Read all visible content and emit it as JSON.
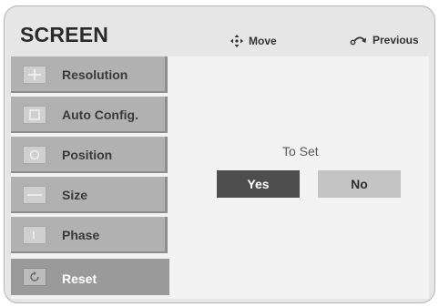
{
  "window": {
    "title": "SCREEN"
  },
  "hints": {
    "move_label": "Move",
    "move_icon": "four-way-arrows-icon",
    "previous_label": "Previous",
    "previous_icon": "return-arrow-icon"
  },
  "menu": {
    "items": [
      {
        "label": "Resolution",
        "icon": "resolution-icon"
      },
      {
        "label": "Auto Config.",
        "icon": "auto-config-icon"
      },
      {
        "label": "Position",
        "icon": "position-icon"
      },
      {
        "label": "Size",
        "icon": "size-icon"
      },
      {
        "label": "Phase",
        "icon": "phase-icon"
      },
      {
        "label": "Reset",
        "icon": "reset-icon",
        "selected": true
      }
    ]
  },
  "dialog": {
    "prompt": "To Set",
    "yes_label": "Yes",
    "no_label": "No",
    "focused": "Yes"
  },
  "colors": {
    "panel_bg": "#e6e6e6",
    "menu_item_bg": "#b1b1b1",
    "selected_item_bg": "#9a9a9a",
    "yes_button_bg": "#4e4e4e",
    "no_button_bg": "#c4c4c4"
  }
}
